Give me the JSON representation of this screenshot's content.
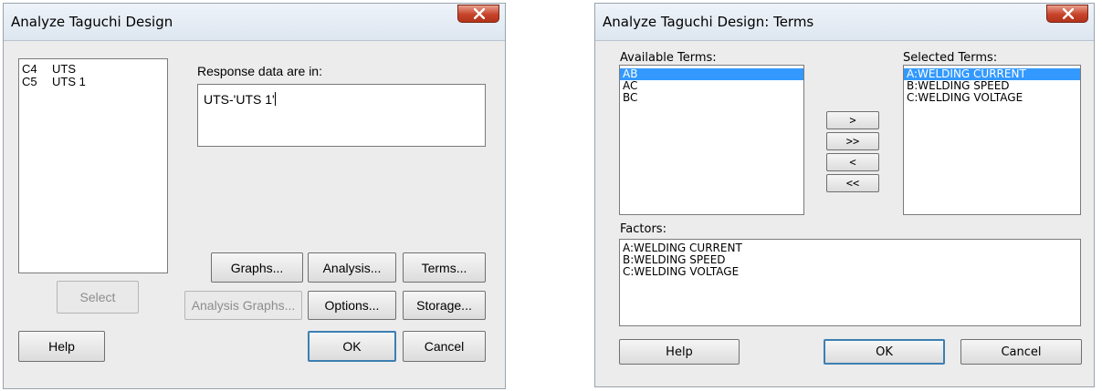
{
  "dialog1": {
    "title": "Analyze Taguchi Design",
    "columns": [
      {
        "code": "C4",
        "name": "UTS"
      },
      {
        "code": "C5",
        "name": "UTS 1"
      }
    ],
    "response_label": "Response data are in:",
    "response_value": "UTS-'UTS 1'",
    "buttons": {
      "select": "Select",
      "graphs": "Graphs...",
      "analysis": "Analysis...",
      "terms": "Terms...",
      "analysis_graphs": "Analysis Graphs...",
      "options": "Options...",
      "storage": "Storage...",
      "help": "Help",
      "ok": "OK",
      "cancel": "Cancel"
    }
  },
  "dialog2": {
    "title": "Analyze Taguchi Design: Terms",
    "available_label": "Available Terms:",
    "available_terms": [
      "AB",
      "AC",
      "BC"
    ],
    "selected_label": "Selected Terms:",
    "selected_terms": [
      "A:WELDING CURRENT",
      "B:WELDING SPEED",
      "C:WELDING VOLTAGE"
    ],
    "factors_label": "Factors:",
    "factors": [
      "A:WELDING CURRENT",
      "B:WELDING SPEED",
      "C:WELDING VOLTAGE"
    ],
    "move_buttons": {
      "add": ">",
      "add_all": ">>",
      "remove": "<",
      "remove_all": "<<"
    },
    "buttons": {
      "help": "Help",
      "ok": "OK",
      "cancel": "Cancel"
    }
  },
  "colors": {
    "selection": "#3399ff",
    "close_button": "#c7432a",
    "dialog_bg": "#ececec"
  }
}
